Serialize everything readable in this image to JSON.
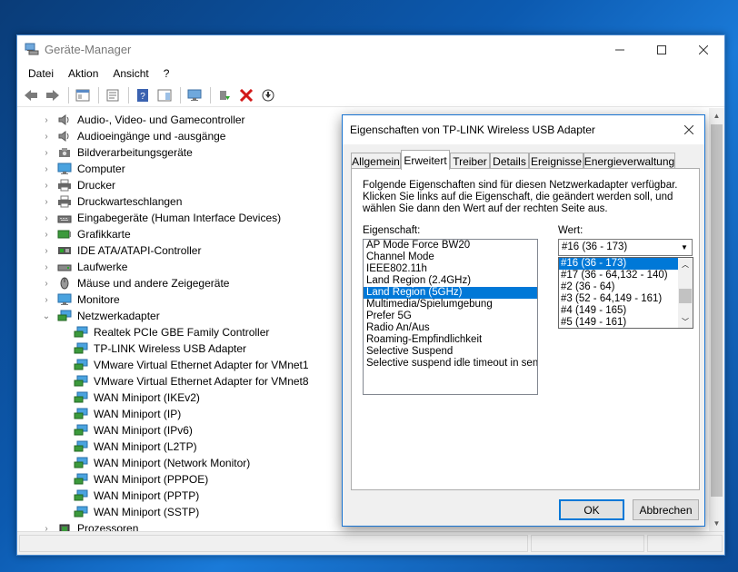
{
  "window": {
    "title": "Geräte-Manager"
  },
  "menu": [
    "Datei",
    "Aktion",
    "Ansicht",
    "?"
  ],
  "tree": [
    {
      "label": "Audio-, Video- und Gamecontroller",
      "level": 1,
      "expanded": false,
      "icon": "speaker-icon"
    },
    {
      "label": "Audioeingänge und -ausgänge",
      "level": 1,
      "expanded": false,
      "icon": "speaker-icon"
    },
    {
      "label": "Bildverarbeitungsgeräte",
      "level": 1,
      "expanded": false,
      "icon": "camera-icon"
    },
    {
      "label": "Computer",
      "level": 1,
      "expanded": false,
      "icon": "monitor-icon"
    },
    {
      "label": "Drucker",
      "level": 1,
      "expanded": false,
      "icon": "printer-icon"
    },
    {
      "label": "Druckwarteschlangen",
      "level": 1,
      "expanded": false,
      "icon": "printer-icon"
    },
    {
      "label": "Eingabegeräte (Human Interface Devices)",
      "level": 1,
      "expanded": false,
      "icon": "hid-icon"
    },
    {
      "label": "Grafikkarte",
      "level": 1,
      "expanded": false,
      "icon": "display-adapter-icon"
    },
    {
      "label": "IDE ATA/ATAPI-Controller",
      "level": 1,
      "expanded": false,
      "icon": "ide-controller-icon"
    },
    {
      "label": "Laufwerke",
      "level": 1,
      "expanded": false,
      "icon": "drive-icon"
    },
    {
      "label": "Mäuse und andere Zeigegeräte",
      "level": 1,
      "expanded": false,
      "icon": "mouse-icon"
    },
    {
      "label": "Monitore",
      "level": 1,
      "expanded": false,
      "icon": "monitor-icon"
    },
    {
      "label": "Netzwerkadapter",
      "level": 1,
      "expanded": true,
      "icon": "network-adapter-icon"
    },
    {
      "label": "Realtek PCIe GBE Family Controller",
      "level": 2,
      "icon": "network-adapter-icon"
    },
    {
      "label": "TP-LINK Wireless USB Adapter",
      "level": 2,
      "icon": "network-adapter-icon"
    },
    {
      "label": "VMware Virtual Ethernet Adapter for VMnet1",
      "level": 2,
      "icon": "network-adapter-icon"
    },
    {
      "label": "VMware Virtual Ethernet Adapter for VMnet8",
      "level": 2,
      "icon": "network-adapter-icon"
    },
    {
      "label": "WAN Miniport (IKEv2)",
      "level": 2,
      "icon": "network-adapter-icon"
    },
    {
      "label": "WAN Miniport (IP)",
      "level": 2,
      "icon": "network-adapter-icon"
    },
    {
      "label": "WAN Miniport (IPv6)",
      "level": 2,
      "icon": "network-adapter-icon"
    },
    {
      "label": "WAN Miniport (L2TP)",
      "level": 2,
      "icon": "network-adapter-icon"
    },
    {
      "label": "WAN Miniport (Network Monitor)",
      "level": 2,
      "icon": "network-adapter-icon"
    },
    {
      "label": "WAN Miniport (PPPOE)",
      "level": 2,
      "icon": "network-adapter-icon"
    },
    {
      "label": "WAN Miniport (PPTP)",
      "level": 2,
      "icon": "network-adapter-icon"
    },
    {
      "label": "WAN Miniport (SSTP)",
      "level": 2,
      "icon": "network-adapter-icon"
    },
    {
      "label": "Prozessoren",
      "level": 1,
      "expanded": false,
      "icon": "processor-icon"
    }
  ],
  "dialog": {
    "title": "Eigenschaften von TP-LINK Wireless USB Adapter",
    "tabs": [
      "Allgemein",
      "Erweitert",
      "Treiber",
      "Details",
      "Ereignisse",
      "Energieverwaltung"
    ],
    "active_tab": 1,
    "description_lines": [
      "Folgende Eigenschaften sind für diesen Netzwerkadapter verfügbar.",
      "Klicken Sie links auf die Eigenschaft, die geändert werden soll, und",
      "wählen Sie dann den Wert auf der rechten Seite aus."
    ],
    "property_label": "Eigenschaft:",
    "value_label": "Wert:",
    "properties": [
      "AP Mode Force BW20",
      "Channel Mode",
      "IEEE802.11h",
      "Land Region (2.4GHz)",
      "Land Region (5GHz)",
      "Multimedia/Spielumgebung",
      "Prefer 5G",
      "Radio An/Aus",
      "Roaming-Empfindlichkeit",
      "Selective Suspend",
      "Selective suspend idle timeout in senond"
    ],
    "selected_property": 4,
    "value_selected": "#16 (36 - 173)",
    "value_options": [
      "#16 (36 - 173)",
      "#17 (36 - 64,132 - 140)",
      "#2 (36 - 64)",
      "#3 (52 - 64,149 - 161)",
      "#4 (149 - 165)",
      "#5 (149 - 161)"
    ],
    "highlighted_option": 0,
    "ok_label": "OK",
    "cancel_label": "Abbrechen"
  },
  "colors": {
    "selection": "#0078d7",
    "dialog_border": "#1873d1",
    "desktop": "#0c5ab0"
  }
}
